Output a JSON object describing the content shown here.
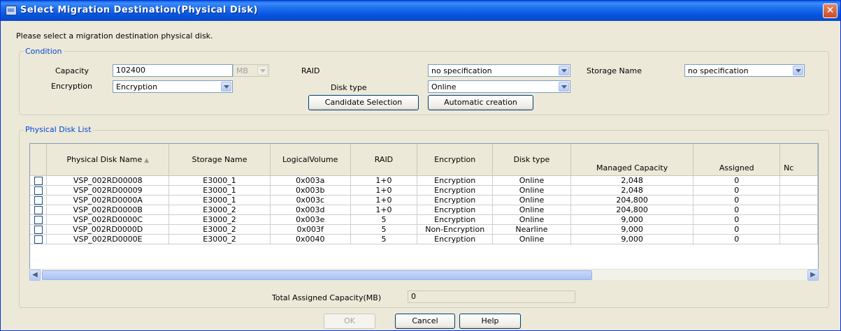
{
  "window": {
    "title": "Select Migration Destination(Physical Disk)",
    "close_glyph": "✕"
  },
  "instruction": "Please select a migration destination physical disk.",
  "condition": {
    "group_label": "Condition",
    "capacity_label": "Capacity",
    "capacity_value": "102400",
    "capacity_unit": "MB",
    "raid_label": "RAID",
    "raid_value": "no specification",
    "storage_name_label": "Storage Name",
    "storage_name_value": "no specification",
    "encryption_label": "Encryption",
    "encryption_value": "Encryption",
    "disk_type_label": "Disk type",
    "disk_type_value": "Online",
    "candidate_button": "Candidate Selection",
    "automatic_button": "Automatic creation"
  },
  "disk_list": {
    "group_label": "Physical Disk List",
    "columns": {
      "name": "Physical Disk Name",
      "storage": "Storage Name",
      "volume": "LogicalVolume",
      "raid": "RAID",
      "encryption": "Encryption",
      "disk_type": "Disk type",
      "managed": "Managed Capacity",
      "assigned": "Assigned",
      "next": "Nc"
    },
    "rows": [
      {
        "name": "VSP_002RD00008",
        "storage": "E3000_1",
        "volume": "0x003a",
        "raid": "1+0",
        "encryption": "Encryption",
        "disk_type": "Online",
        "managed": "2,048",
        "assigned": "0"
      },
      {
        "name": "VSP_002RD00009",
        "storage": "E3000_1",
        "volume": "0x003b",
        "raid": "1+0",
        "encryption": "Encryption",
        "disk_type": "Online",
        "managed": "2,048",
        "assigned": "0"
      },
      {
        "name": "VSP_002RD0000A",
        "storage": "E3000_1",
        "volume": "0x003c",
        "raid": "1+0",
        "encryption": "Encryption",
        "disk_type": "Online",
        "managed": "204,800",
        "assigned": "0"
      },
      {
        "name": "VSP_002RD0000B",
        "storage": "E3000_2",
        "volume": "0x003d",
        "raid": "1+0",
        "encryption": "Encryption",
        "disk_type": "Online",
        "managed": "204,800",
        "assigned": "0"
      },
      {
        "name": "VSP_002RD0000C",
        "storage": "E3000_2",
        "volume": "0x003e",
        "raid": "5",
        "encryption": "Encryption",
        "disk_type": "Online",
        "managed": "9,000",
        "assigned": "0"
      },
      {
        "name": "VSP_002RD0000D",
        "storage": "E3000_2",
        "volume": "0x003f",
        "raid": "5",
        "encryption": "Non-Encryption",
        "disk_type": "Nearline",
        "managed": "9,000",
        "assigned": "0"
      },
      {
        "name": "VSP_002RD0000E",
        "storage": "E3000_2",
        "volume": "0x0040",
        "raid": "5",
        "encryption": "Encryption",
        "disk_type": "Online",
        "managed": "9,000",
        "assigned": "0"
      }
    ],
    "total_label": "Total Assigned Capacity(MB)",
    "total_value": "0"
  },
  "buttons": {
    "ok": "OK",
    "cancel": "Cancel",
    "help": "Help"
  }
}
